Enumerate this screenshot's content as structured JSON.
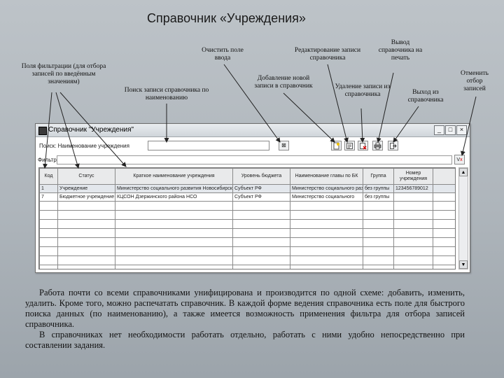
{
  "slide": {
    "title": "Справочник «Учреждения»",
    "callouts": {
      "filter_fields": "Поля фильтрации (для отбора записей по введённым значениям)",
      "clear_input": "Очистить поле ввода",
      "search_by_name": "Поиск записи справочника по наименованию",
      "edit_record": "Редактирование записи справочника",
      "add_record": "Добавление новой записи в справочник",
      "delete_record": "Удаление записи из справочника",
      "print": "Вывод справочника на печать",
      "exit": "Выход из справочника",
      "cancel_filter": "Отменить отбор записей"
    },
    "body": [
      "Работа почти со всеми справочниками унифицирована и производится по одной схеме: добавить, изменить, удалить. Кроме того, можно распечатать справочник. В каждой форме ведения справочника есть поле для быстрого поиска данных (по наименованию), а также имеется возможность применения фильтра для отбора записей справочника.",
      "В справочниках нет необходимости работать отдельно, работать с ними удобно непосредственно при составлении задания."
    ]
  },
  "window": {
    "title": "Справочник \"Учреждения\"",
    "controls": {
      "minimize": "_",
      "maximize": "□",
      "close": "×"
    },
    "search_label": "Поиск: Наименование учреждения",
    "search_value": "",
    "filter_label": "Фильтр",
    "toolbar_icons": [
      "clear-input-icon",
      "add-record-icon",
      "edit-record-icon",
      "delete-record-icon",
      "print-icon",
      "exit-icon"
    ],
    "columns": [
      "Код",
      "Статус",
      "Краткое наименование учреждения",
      "Уровень бюджета",
      "Наименование главы по БК",
      "Группа",
      "Номер учреждения"
    ],
    "rows": [
      [
        "1",
        "Учреждение",
        "Министерство социального развития Новосибирской обл.",
        "Субъект РФ",
        "Министерство социального развития",
        "без группы",
        "123456789012"
      ],
      [
        "7",
        "Бюджетное учреждение",
        "КЦСОН Дзержинского района НСО",
        "Субъект РФ",
        "Министерство социального",
        "без группы",
        ""
      ]
    ]
  },
  "colors": {
    "background": "#b4babf",
    "window_title": "#d9dee2",
    "selected_row": "#e3e7ec"
  }
}
